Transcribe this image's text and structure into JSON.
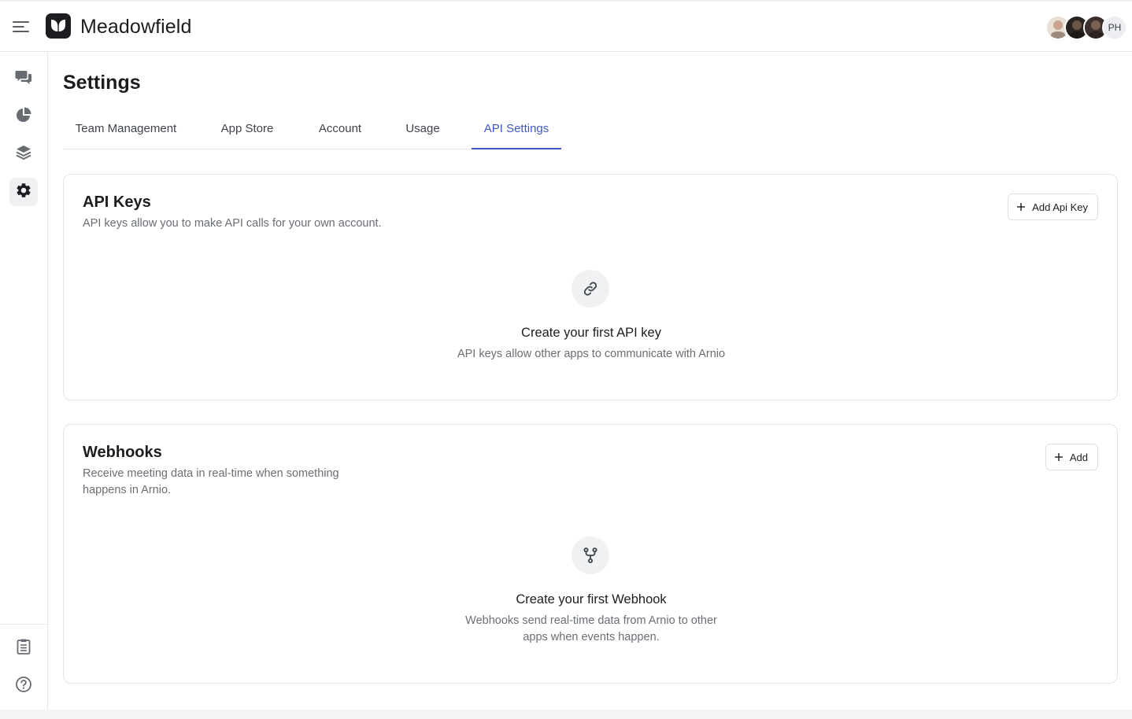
{
  "brand": {
    "name": "Meadowfield"
  },
  "header": {
    "avatars": [
      {
        "type": "photo",
        "color": "#c7a58e"
      },
      {
        "type": "photo",
        "color": "#3b2f2a"
      },
      {
        "type": "photo",
        "color": "#4a3b36"
      },
      {
        "type": "initials",
        "text": "PH"
      }
    ]
  },
  "sidebar": {
    "items": [
      {
        "icon": "chat-bubbles-icon"
      },
      {
        "icon": "pie-chart-icon"
      },
      {
        "icon": "layers-icon"
      },
      {
        "icon": "gear-icon",
        "active": true
      }
    ],
    "bottom_items": [
      {
        "icon": "clipboard-icon"
      },
      {
        "icon": "help-circle-icon"
      }
    ]
  },
  "page": {
    "title": "Settings"
  },
  "tabs": [
    {
      "label": "Team Management"
    },
    {
      "label": "App Store"
    },
    {
      "label": "Account"
    },
    {
      "label": "Usage"
    },
    {
      "label": "API Settings",
      "active": true
    }
  ],
  "api_keys": {
    "title": "API Keys",
    "description": "API keys allow you to make API calls for your own account.",
    "button_label": "Add Api Key",
    "empty_title": "Create your first API key",
    "empty_description": "API keys allow other apps to communicate with Arnio"
  },
  "webhooks": {
    "title": "Webhooks",
    "description": "Receive meeting data in real-time when something happens in Arnio.",
    "button_label": "Add",
    "empty_title": "Create your first Webhook",
    "empty_description": "Webhooks send real-time data from Arnio to other apps when events happen."
  },
  "colors": {
    "accent": "#3f56c9",
    "text_primary": "#1b1d21",
    "text_muted": "#6a6e75",
    "border": "#e3e5e8"
  }
}
